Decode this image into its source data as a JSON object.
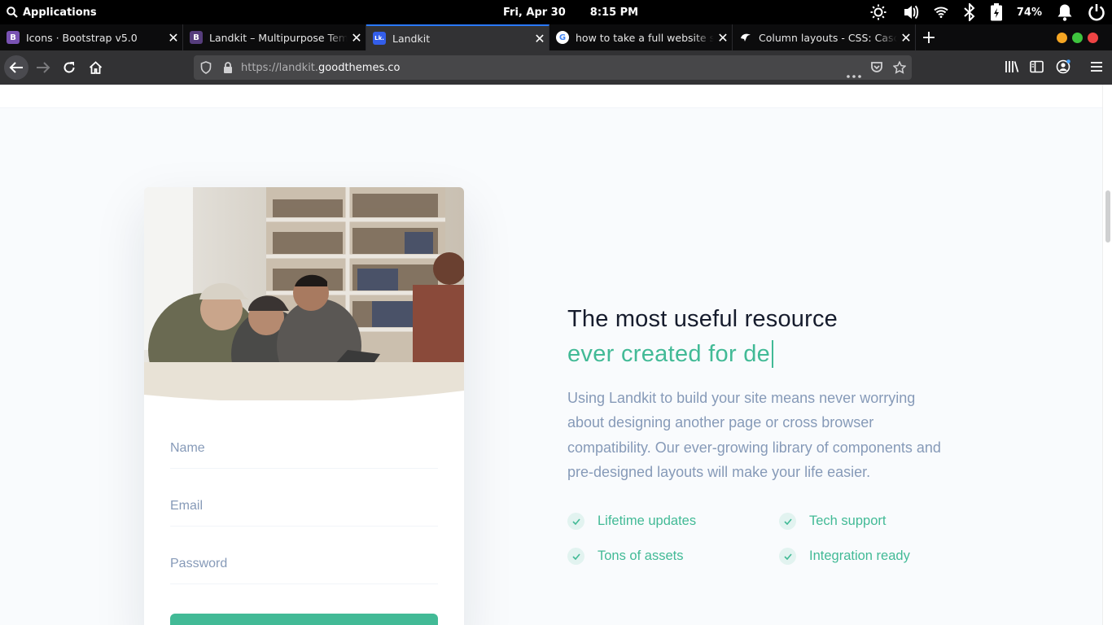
{
  "system_bar": {
    "apps_label": "Applications",
    "date": "Fri, Apr 30",
    "time": "8:15 PM",
    "battery": "74%",
    "icons": [
      "search-icon",
      "brightness-icon",
      "volume-icon",
      "wifi-icon",
      "bluetooth-icon",
      "battery-icon",
      "notification-bell-icon",
      "power-icon"
    ]
  },
  "browser": {
    "tabs": [
      {
        "title": "Icons · Bootstrap v5.0",
        "favicon": "B",
        "favicon_color": "#7952b3",
        "active": false
      },
      {
        "title": "Landkit – Multipurpose Template",
        "favicon": "B",
        "favicon_color": "#563d7c",
        "active": false
      },
      {
        "title": "Landkit",
        "favicon": "Lk.",
        "favicon_color": "#335eea",
        "active": true
      },
      {
        "title": "how to take a full website screenshot",
        "favicon": "G",
        "favicon_color": "#ffffff",
        "active": false
      },
      {
        "title": "Column layouts - CSS: Cascading",
        "favicon": "mdn",
        "favicon_color": "#000000",
        "active": false
      }
    ],
    "url_prefix": "https://landkit.",
    "url_domain": "goodthemes.co"
  },
  "form": {
    "name_placeholder": "Name",
    "email_placeholder": "Email",
    "password_placeholder": "Password"
  },
  "hero": {
    "title": "The most useful resource",
    "typed": "ever created for de",
    "lead": "Using Landkit to build your site means never worrying about designing another page or cross browser compatibility. Our ever-growing library of components and pre-designed layouts will make your life easier."
  },
  "features": [
    "Lifetime updates",
    "Tech support",
    "Tons of assets",
    "Integration ready"
  ],
  "colors": {
    "accent": "#42ba96",
    "heading": "#161c2d",
    "muted": "#869ab8",
    "page_bg": "#f9fbfd",
    "tab_active_line": "#2a79ff"
  }
}
